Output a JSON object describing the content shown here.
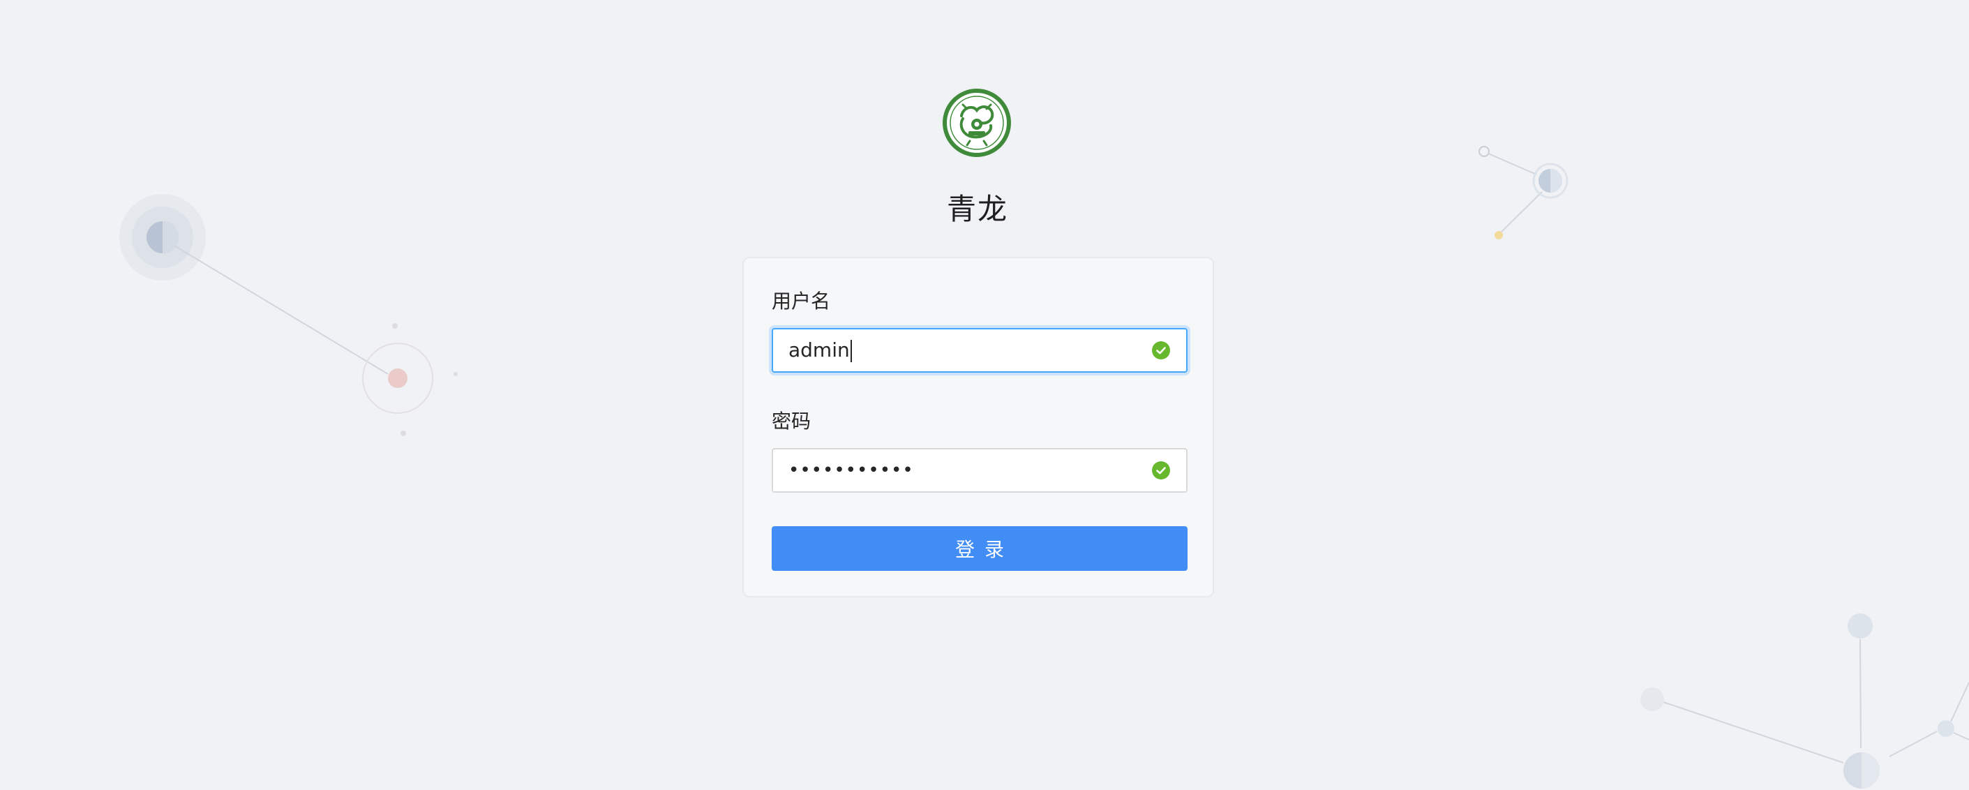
{
  "app": {
    "title": "青龙",
    "logo_icon": "qinglong-dragon-logo-icon"
  },
  "form": {
    "username_label": "用户名",
    "username_value": "admin",
    "password_label": "密码",
    "password_mask": "•••••••••••",
    "submit_label": "登录"
  },
  "colors": {
    "primary": "#428df5",
    "success": "#67b82f",
    "logo_green": "#3f8b3a",
    "background": "#f0f2f5"
  }
}
